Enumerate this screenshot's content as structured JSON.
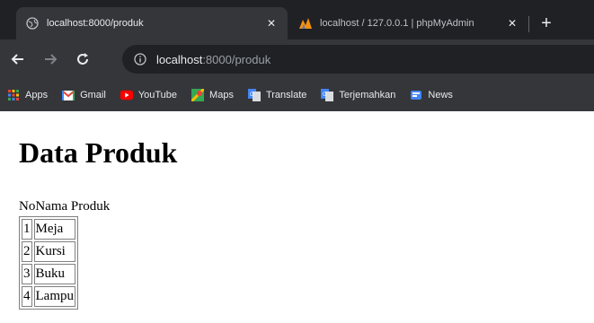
{
  "browser": {
    "tabs": [
      {
        "title": "localhost:8000/produk",
        "active": true,
        "favicon": "globe-icon"
      },
      {
        "title": "localhost / 127.0.0.1 | phpMyAdmin",
        "active": false,
        "favicon": "phpmyadmin-icon"
      }
    ],
    "address": {
      "host": "localhost",
      "rest": ":8000/produk"
    },
    "bookmarks": [
      {
        "label": "Apps",
        "icon": "apps-grid-icon"
      },
      {
        "label": "Gmail",
        "icon": "gmail-icon"
      },
      {
        "label": "YouTube",
        "icon": "youtube-icon"
      },
      {
        "label": "Maps",
        "icon": "maps-icon"
      },
      {
        "label": "Translate",
        "icon": "translate-icon"
      },
      {
        "label": "Terjemahkan",
        "icon": "translate-icon"
      },
      {
        "label": "News",
        "icon": "news-icon"
      }
    ]
  },
  "page": {
    "heading": "Data Produk",
    "columns": [
      "No",
      "Nama Produk"
    ],
    "rows": [
      {
        "no": "1",
        "nama": "Meja"
      },
      {
        "no": "2",
        "nama": "Kursi"
      },
      {
        "no": "3",
        "nama": "Buku"
      },
      {
        "no": "4",
        "nama": "Lampu"
      }
    ]
  }
}
